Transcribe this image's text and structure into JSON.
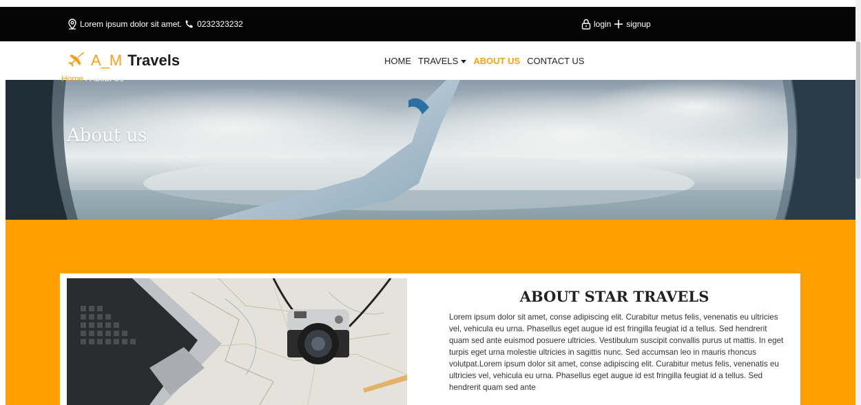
{
  "topbar": {
    "address": "Lorem ipsum dolor sit amet.",
    "phone": "0232323232",
    "login": "login",
    "signup": "signup"
  },
  "brand": {
    "part1": "A_M",
    "part2": "Travels",
    "icon": "airplane-icon",
    "accent_color": "#f7a21a"
  },
  "nav": {
    "home": "HOME",
    "travels": "TRAVELS",
    "about": "ABOUT US",
    "contact": "CONTACT US"
  },
  "hero": {
    "title": "About us",
    "breadcrumb_home": "Home",
    "breadcrumb_separator": " / ",
    "breadcrumb_current": "About Us"
  },
  "about": {
    "title": "ABOUT STAR TRAVELS",
    "text": "Lorem ipsum dolor sit amet, conse adipiscing elit. Curabitur metus felis, venenatis eu ultricies vel, vehicula eu urna. Phasellus eget augue id est fringilla feugiat id a tellus. Sed hendrerit quam sed ante euismod posuere ultricies. Vestibulum suscipit convallis purus ut mattis. In eget turpis eget urna molestie ultricies in sagittis nunc. Sed accumsan leo in mauris rhoncus volutpat.Lorem ipsum dolor sit amet, conse adipiscing elit. Curabitur metus felis, venenatis eu ultricies vel, vehicula eu urna. Phasellus eget augue id est fringilla feugiat id a tellus. Sed hendrerit quam sed ante"
  },
  "colors": {
    "topbar_bg": "#050505",
    "section_bg": "#ff9f00",
    "accent": "#f7a21a"
  }
}
